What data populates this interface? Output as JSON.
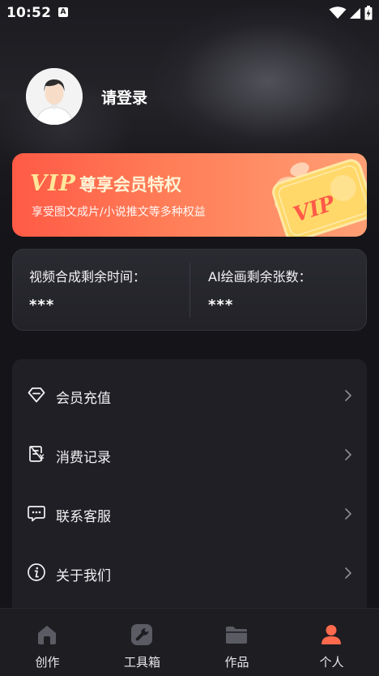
{
  "status_bar": {
    "time": "10:52",
    "notification_icon": "A"
  },
  "profile": {
    "login_prompt": "请登录",
    "avatar_icon": "default-avatar-icon"
  },
  "vip_banner": {
    "title_vip": "VIP",
    "title_rest": "尊享会员特权",
    "subtitle": "享受图文成片/小说推文等多种权益",
    "card_label": "VIP"
  },
  "quota": {
    "video_label": "视频合成剩余时间：",
    "video_value": "***",
    "ai_label": "AI绘画剩余张数：",
    "ai_value": "***"
  },
  "menu": {
    "items": [
      {
        "label": "会员充值",
        "icon": "diamond-icon"
      },
      {
        "label": "消费记录",
        "icon": "receipt-icon"
      },
      {
        "label": "联系客服",
        "icon": "chat-icon"
      },
      {
        "label": "关于我们",
        "icon": "info-icon"
      }
    ]
  },
  "tabs": [
    {
      "label": "创作",
      "icon": "home-icon"
    },
    {
      "label": "工具箱",
      "icon": "wrench-icon"
    },
    {
      "label": "作品",
      "icon": "folder-icon"
    },
    {
      "label": "个人",
      "icon": "person-icon",
      "active": true
    }
  ],
  "colors": {
    "accent": "#ff6a4d",
    "vip_gold": "#ffe79a",
    "background": "#141419",
    "card": "#1f1f25"
  }
}
